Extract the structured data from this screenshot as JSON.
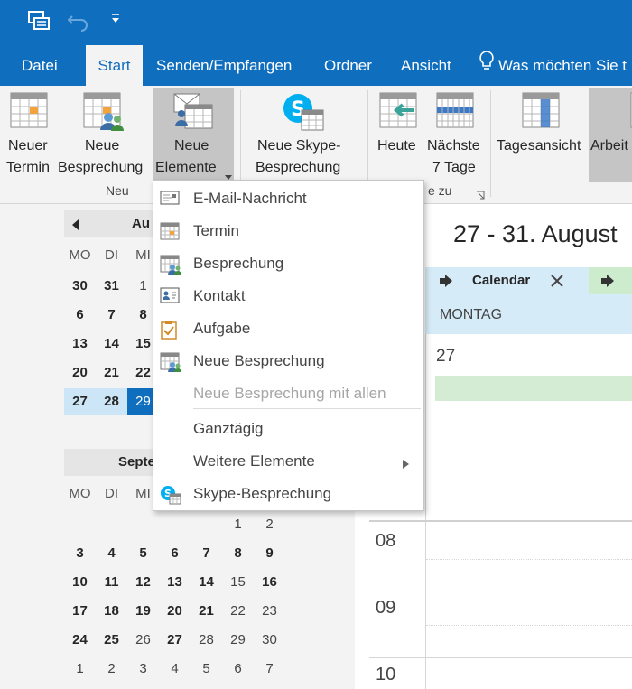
{
  "quick_access": {
    "icons": [
      "send-receive-icon",
      "undo-icon",
      "customize-quick-access-icon"
    ]
  },
  "tabs": [
    "Datei",
    "Start",
    "Senden/Empfangen",
    "Ordner",
    "Ansicht"
  ],
  "tell_me": "Was möchten Sie t",
  "ribbon": {
    "new_appointment": [
      "Neuer",
      "Termin"
    ],
    "new_meeting": [
      "Neue",
      "Besprechung"
    ],
    "new_items": [
      "Neue",
      "Elemente"
    ],
    "new_skype_meeting": [
      "Neue Skype-",
      "Besprechung"
    ],
    "group_new": "Neu",
    "today": "Heute",
    "next_7_days": [
      "Nächste",
      "7 Tage"
    ],
    "group_goto_partial": "e zu",
    "day_view": "Tagesansicht",
    "work_week": "Arbeit"
  },
  "new_items_menu": {
    "items": [
      {
        "label": "E-Mail-Nachricht",
        "icon": "email-icon",
        "enabled": true
      },
      {
        "label": "Termin",
        "icon": "appointment-icon",
        "enabled": true
      },
      {
        "label": "Besprechung",
        "icon": "meeting-icon",
        "enabled": true
      },
      {
        "label": "Kontakt",
        "icon": "contact-icon",
        "enabled": true
      },
      {
        "label": "Aufgabe",
        "icon": "task-icon",
        "enabled": true
      },
      {
        "label": "Neue Besprechung",
        "icon": "meeting-icon",
        "enabled": true
      },
      {
        "label": "Neue Besprechung mit allen",
        "icon": "",
        "enabled": false
      },
      {
        "label": "Ganztägig",
        "icon": "",
        "enabled": true
      },
      {
        "label": "Weitere Elemente",
        "icon": "",
        "enabled": true,
        "submenu": true
      },
      {
        "label": "Skype-Besprechung",
        "icon": "skype-icon",
        "enabled": true
      }
    ]
  },
  "mini_calendar": {
    "august": {
      "title": "Au",
      "weekdays": [
        "MO",
        "DI",
        "MI"
      ],
      "weeks": [
        [
          "30",
          "31",
          "1"
        ],
        [
          "6",
          "7",
          "8"
        ],
        [
          "13",
          "14",
          "15"
        ],
        [
          "20",
          "21",
          "22"
        ],
        [
          "27",
          "28",
          "29"
        ]
      ]
    },
    "september": {
      "title": "Septe",
      "weekdays": [
        "MO",
        "DI",
        "MI"
      ],
      "weeks": [
        [
          "",
          "",
          "",
          "",
          "",
          "1",
          "2"
        ],
        [
          "3",
          "4",
          "5",
          "6",
          "7",
          "8",
          "9"
        ],
        [
          "10",
          "11",
          "12",
          "13",
          "14",
          "15",
          "16"
        ],
        [
          "17",
          "18",
          "19",
          "20",
          "21",
          "22",
          "23"
        ],
        [
          "24",
          "25",
          "26",
          "27",
          "28",
          "29",
          "30"
        ],
        [
          "1",
          "2",
          "3",
          "4",
          "5",
          "6",
          "7"
        ]
      ]
    }
  },
  "calendar": {
    "range_title": "27 - 31. August",
    "tab_label": "Calendar",
    "day_name": "MONTAG",
    "day_number": "27",
    "hours": [
      "08",
      "09",
      "10"
    ]
  },
  "colors": {
    "accent": "#106ebe",
    "ribbon": "#f3f3f3",
    "selection": "#cde6f7",
    "all_day": "#d4ecd4"
  }
}
